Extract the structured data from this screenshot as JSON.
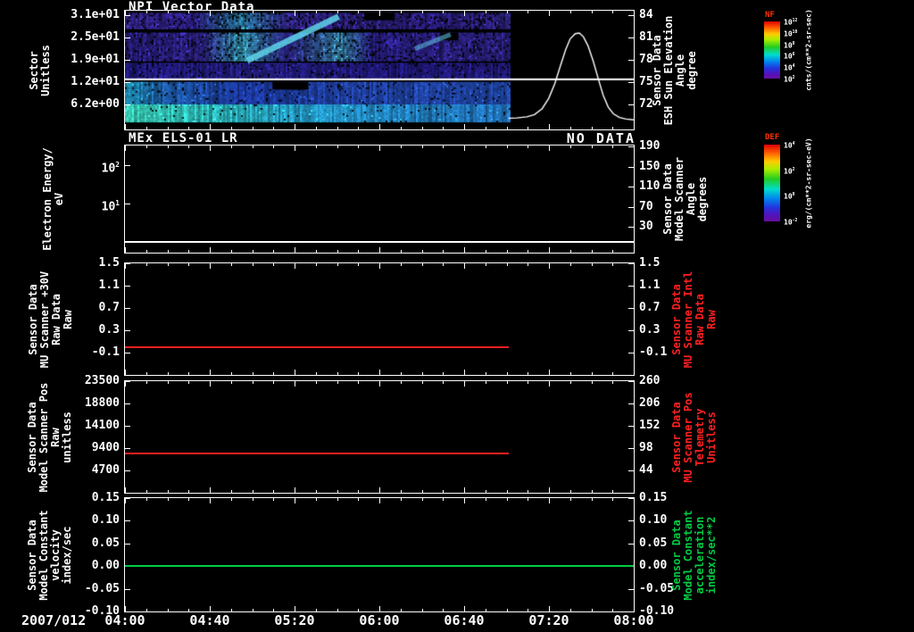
{
  "xaxis": {
    "date_label": "2007/012",
    "tick_labels": [
      "04:00",
      "04:40",
      "05:20",
      "06:00",
      "06:40",
      "07:20",
      "08:00"
    ]
  },
  "panels": [
    {
      "title": "NPI Vector Data",
      "left_title_lines": [
        "Sector",
        "Unitless"
      ],
      "left_ticks": [
        {
          "label": "3.1e+01",
          "f": 0.038
        },
        {
          "label": "2.5e+01",
          "f": 0.226
        },
        {
          "label": "1.9e+01",
          "f": 0.414
        },
        {
          "label": "1.2e+01",
          "f": 0.602
        },
        {
          "label": "6.2e+00",
          "f": 0.79
        }
      ],
      "right_title_lines": [
        "Sensor Data",
        "ESH Sun Elevation",
        "Angle",
        "degree"
      ],
      "right_title_color": "#ffffff",
      "right_ticks": [
        {
          "label": "84",
          "f": 0.038
        },
        {
          "label": "81",
          "f": 0.226
        },
        {
          "label": "78",
          "f": 0.414
        },
        {
          "label": "75",
          "f": 0.602
        },
        {
          "label": "72",
          "f": 0.79
        }
      ]
    },
    {
      "title": "MEx ELS-01 LR",
      "status": "NO DATA",
      "left_title_lines": [
        "Electron Energy/",
        "eV"
      ],
      "left_ticks": [
        {
          "label": "10^2",
          "f": 0.183
        },
        {
          "label": "10^1",
          "f": 0.542
        }
      ],
      "right_title_lines": [
        "Sensor Data",
        "Model Scanner",
        "Angle",
        "degrees"
      ],
      "right_title_color": "#ffffff",
      "right_ticks": [
        {
          "label": "190",
          "f": 0.008
        },
        {
          "label": "150",
          "f": 0.196
        },
        {
          "label": "110",
          "f": 0.383
        },
        {
          "label": "70",
          "f": 0.571
        },
        {
          "label": "30",
          "f": 0.758
        }
      ]
    },
    {
      "left_title_lines": [
        "Sensor Data",
        "MU Scanner +30V",
        "Raw Data",
        "Raw"
      ],
      "left_ticks": [
        {
          "label": "1.5",
          "f": 0.0
        },
        {
          "label": "1.1",
          "f": 0.2
        },
        {
          "label": "0.7",
          "f": 0.4
        },
        {
          "label": "0.3",
          "f": 0.6
        },
        {
          "label": "-0.1",
          "f": 0.8
        }
      ],
      "right_title_lines": [
        "Sensor Data",
        "MU Scanner Intl",
        "Raw Data",
        "Raw"
      ],
      "right_title_color": "#ff2020",
      "right_ticks": [
        {
          "label": "1.5",
          "f": 0.0
        },
        {
          "label": "1.1",
          "f": 0.2
        },
        {
          "label": "0.7",
          "f": 0.4
        },
        {
          "label": "0.3",
          "f": 0.6
        },
        {
          "label": "-0.1",
          "f": 0.8
        }
      ]
    },
    {
      "left_title_lines": [
        "Sensor Data",
        "Model Scanner Pos",
        "Raw",
        "unitless"
      ],
      "left_ticks": [
        {
          "label": "23500",
          "f": 0.0
        },
        {
          "label": "18800",
          "f": 0.2
        },
        {
          "label": "14100",
          "f": 0.4
        },
        {
          "label": "9400",
          "f": 0.6
        },
        {
          "label": "4700",
          "f": 0.8
        }
      ],
      "right_title_lines": [
        "Sensor Data",
        "MU Scanner Pos",
        "Telemetry",
        "Unitless"
      ],
      "right_title_color": "#ff2020",
      "right_ticks": [
        {
          "label": "260",
          "f": 0.0
        },
        {
          "label": "206",
          "f": 0.2
        },
        {
          "label": "152",
          "f": 0.4
        },
        {
          "label": "98",
          "f": 0.6
        },
        {
          "label": "44",
          "f": 0.8
        }
      ]
    },
    {
      "left_title_lines": [
        "Sensor Data",
        "Model Constant",
        "velocity",
        "index/sec"
      ],
      "left_ticks": [
        {
          "label": "0.15",
          "f": 0.0
        },
        {
          "label": "0.10",
          "f": 0.2
        },
        {
          "label": "0.05",
          "f": 0.4
        },
        {
          "label": "0.00",
          "f": 0.6
        },
        {
          "label": "-0.05",
          "f": 0.8
        },
        {
          "label": "-0.10",
          "f": 1.0
        }
      ],
      "right_title_lines": [
        "Sensor Data",
        "Model Constant",
        "acceleration",
        "index/sec**2"
      ],
      "right_title_color": "#00cc44",
      "right_ticks": [
        {
          "label": "0.15",
          "f": 0.0
        },
        {
          "label": "0.10",
          "f": 0.2
        },
        {
          "label": "0.05",
          "f": 0.4
        },
        {
          "label": "0.00",
          "f": 0.6
        },
        {
          "label": "-0.05",
          "f": 0.8
        },
        {
          "label": "-0.10",
          "f": 1.0
        }
      ]
    }
  ],
  "colorbars": [
    {
      "name": "NF",
      "ticks": [
        "10^12",
        "10^10",
        "10^8",
        "10^6",
        "10^4",
        "10^2"
      ],
      "units": "cnts/(cm**2-sr-sec)"
    },
    {
      "name": "DEF",
      "ticks": [
        "10^4",
        "10^2",
        "10^0",
        "10^-2"
      ],
      "units": "erg/(cm**2-sr-sec-eV)"
    }
  ],
  "chart_data": [
    {
      "type": "heatmap",
      "title": "NPI Vector Data",
      "x_range": [
        "2007/012 04:00",
        "2007/012 08:00"
      ],
      "ylabel": "Sector (Unitless)",
      "y_ticks": [
        31,
        25,
        19,
        12,
        6.2
      ],
      "data_end_x_frac": 0.755,
      "colorbar_label": "NF",
      "colorbar_units": "cnts/(cm**2-sr-sec)",
      "colorbar_range": [
        "10^2",
        "10^12"
      ],
      "white_row_line_y_frac": 0.578,
      "right_series": {
        "name": "ESH Sun Elevation Angle (degree)",
        "axis_range": [
          68.6,
          84.6
        ],
        "points": [
          [
            0.754,
            70.1
          ],
          [
            0.77,
            70.15
          ],
          [
            0.79,
            70.3
          ],
          [
            0.805,
            70.6
          ],
          [
            0.82,
            71.4
          ],
          [
            0.833,
            72.8
          ],
          [
            0.845,
            74.8
          ],
          [
            0.856,
            77.2
          ],
          [
            0.866,
            79.3
          ],
          [
            0.875,
            80.8
          ],
          [
            0.885,
            81.5
          ],
          [
            0.893,
            81.6
          ],
          [
            0.901,
            81.1
          ],
          [
            0.91,
            79.9
          ],
          [
            0.92,
            77.9
          ],
          [
            0.93,
            75.5
          ],
          [
            0.94,
            73.2
          ],
          [
            0.95,
            71.6
          ],
          [
            0.96,
            70.7
          ],
          [
            0.972,
            70.2
          ],
          [
            0.985,
            70.0
          ],
          [
            1.0,
            69.9
          ]
        ]
      },
      "bands": [
        {
          "y0": 0.02,
          "y1": 0.155,
          "noise": 0.5,
          "dropout": 0.14,
          "stops": [
            [
              0,
              "#4a34c4"
            ],
            [
              0.18,
              "#3c2ab2"
            ],
            [
              0.3,
              "#38a8dc"
            ],
            [
              0.42,
              "#4433bb"
            ],
            [
              0.62,
              "#3f2eb0"
            ],
            [
              0.8,
              "#3827a6"
            ],
            [
              1,
              "#4030b0"
            ]
          ]
        },
        {
          "y0": 0.185,
          "y1": 0.42,
          "noise": 0.5,
          "dropout": 0.1,
          "stops": [
            [
              0,
              "#3626a4"
            ],
            [
              0.2,
              "#4030b8"
            ],
            [
              0.3,
              "#46c6ea"
            ],
            [
              0.42,
              "#3a2eb0"
            ],
            [
              0.56,
              "#48aada"
            ],
            [
              0.64,
              "#3428a8"
            ],
            [
              0.85,
              "#3c2cac"
            ],
            [
              1,
              "#3a2ca8"
            ]
          ]
        },
        {
          "y0": 0.44,
          "y1": 0.565,
          "noise": 0.38,
          "dropout": 0.08,
          "stops": [
            [
              0,
              "#2a22a2"
            ],
            [
              0.35,
              "#3028a8"
            ],
            [
              0.7,
              "#281f98"
            ],
            [
              1,
              "#2c24a0"
            ]
          ]
        },
        {
          "y0": 0.6,
          "y1": 0.79,
          "noise": 0.32,
          "dropout": 0.05,
          "stops": [
            [
              0,
              "#28b4e4"
            ],
            [
              0.1,
              "#2470cc"
            ],
            [
              0.3,
              "#2244c0"
            ],
            [
              0.55,
              "#2850c8"
            ],
            [
              1,
              "#2754c6"
            ]
          ]
        },
        {
          "y0": 0.79,
          "y1": 0.935,
          "noise": 0.24,
          "dropout": 0.03,
          "stops": [
            [
              0,
              "#40e4c8"
            ],
            [
              0.22,
              "#34d8d8"
            ],
            [
              0.45,
              "#2ab0e0"
            ],
            [
              0.72,
              "#2692d8"
            ],
            [
              1,
              "#2680d2"
            ]
          ]
        }
      ],
      "streaks": [
        {
          "x0": 0.24,
          "y0": 0.42,
          "x1": 0.42,
          "y1": 0.05,
          "w": 7,
          "color": "rgba(100,225,245,0.8)"
        },
        {
          "x0": 0.57,
          "y0": 0.32,
          "x1": 0.64,
          "y1": 0.2,
          "w": 5,
          "color": "rgba(100,200,240,0.55)"
        }
      ],
      "black_patches": [
        {
          "x0": 0.29,
          "x1": 0.36,
          "y0": 0.6,
          "y1": 0.665
        },
        {
          "x0": 0.47,
          "x1": 0.53,
          "y0": 0.02,
          "y1": 0.08
        },
        {
          "x0": 0.62,
          "x1": 0.655,
          "y0": 0.185,
          "y1": 0.25
        }
      ]
    },
    {
      "type": "heatmap",
      "title": "MEx ELS-01 LR",
      "status": "NO DATA",
      "ylabel": "Electron Energy (eV)",
      "y_scale": "log",
      "y_ticks": [
        100,
        10
      ],
      "colorbar_label": "DEF",
      "colorbar_units": "erg/(cm**2-sr-sec-eV)",
      "white_line_y_frac": 0.9
    },
    {
      "type": "line",
      "ylabel": "Sensor Data MU Scanner +30V Raw Data (Raw)",
      "ylim": [
        -0.5,
        1.5
      ],
      "y_ticks": [
        1.5,
        1.1,
        0.7,
        0.3,
        -0.1
      ],
      "series": [
        {
          "name": "MU Scanner +30V Raw",
          "color": "#ff2020",
          "value": 0.0,
          "x_start_frac": 0.0,
          "x_end_frac": 0.755
        }
      ]
    },
    {
      "type": "line",
      "ylabel": "Sensor Data Model Scanner Pos Raw (unitless)",
      "ylim": [
        0,
        23500
      ],
      "y_ticks": [
        23500,
        18800,
        14100,
        9400,
        4700
      ],
      "right_ylim": [
        -10,
        260
      ],
      "right_y_ticks": [
        260,
        206,
        152,
        98,
        44
      ],
      "series": [
        {
          "name": "Model Scanner Pos Raw",
          "color": "#ff2020",
          "value": 8300,
          "x_start_frac": 0.0,
          "x_end_frac": 0.755
        }
      ]
    },
    {
      "type": "line",
      "ylabel": "Sensor Data Model Constant velocity (index/sec)",
      "ylim": [
        -0.1,
        0.15
      ],
      "y_ticks": [
        0.15,
        0.1,
        0.05,
        0.0,
        -0.05,
        -0.1
      ],
      "series": [
        {
          "name": "Model Constant velocity",
          "color": "#00cc44",
          "value": 0.0,
          "x_start_frac": 0.0,
          "x_end_frac": 1.0
        }
      ]
    }
  ]
}
